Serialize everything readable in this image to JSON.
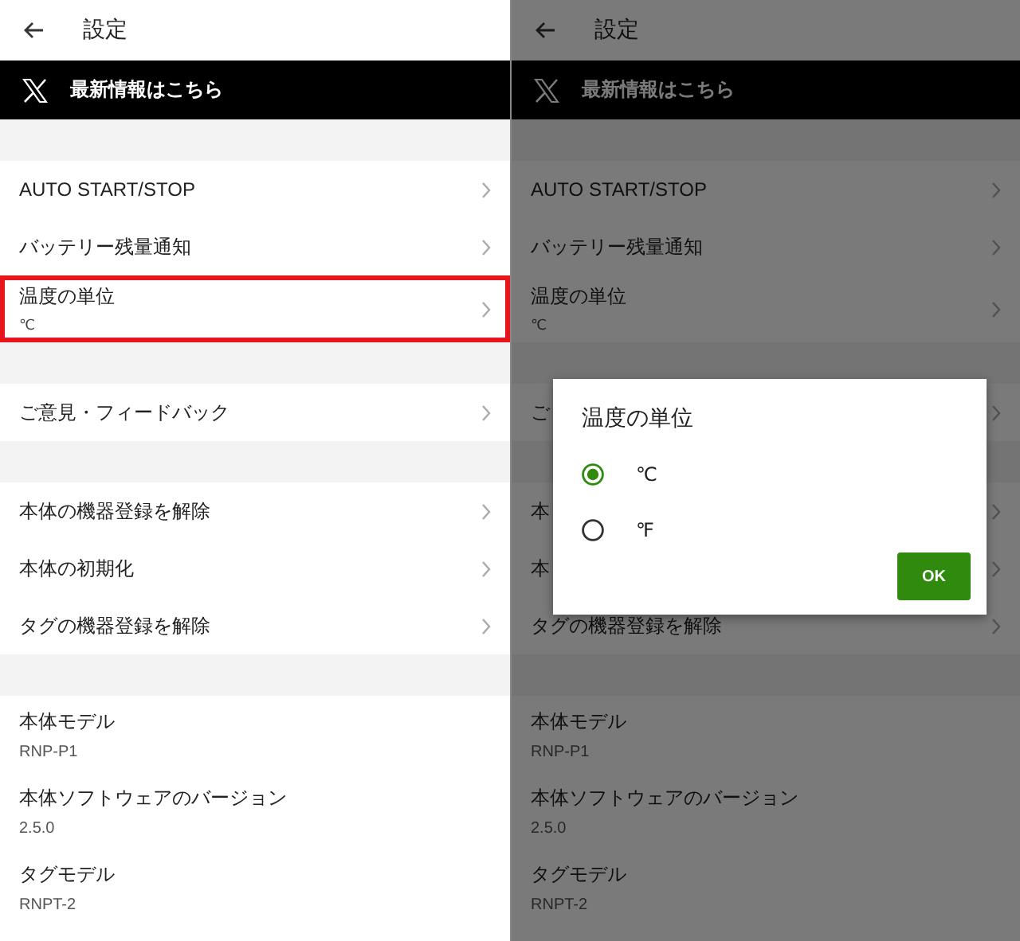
{
  "screens": [
    {
      "header": {
        "title": "設定"
      },
      "banner": {
        "text": "最新情報はこちら"
      },
      "dimmed": false,
      "groups": [
        {
          "items": [
            {
              "label": "AUTO START/STOP",
              "highlighted": false
            },
            {
              "label": "バッテリー残量通知",
              "highlighted": false
            },
            {
              "label": "温度の単位",
              "value": "℃",
              "highlighted": true
            }
          ]
        },
        {
          "items": [
            {
              "label": "ご意見・フィードバック",
              "highlighted": false
            }
          ]
        },
        {
          "items": [
            {
              "label": "本体の機器登録を解除",
              "highlighted": false
            },
            {
              "label": "本体の初期化",
              "highlighted": false
            },
            {
              "label": "タグの機器登録を解除",
              "highlighted": false
            }
          ]
        }
      ],
      "info": [
        {
          "label": "本体モデル",
          "value": "RNP-P1"
        },
        {
          "label": "本体ソフトウェアのバージョン",
          "value": "2.5.0"
        },
        {
          "label": "タグモデル",
          "value": "RNPT-2"
        }
      ]
    },
    {
      "header": {
        "title": "設定"
      },
      "banner": {
        "text": "最新情報はこちら"
      },
      "dimmed": true,
      "groups": [
        {
          "items": [
            {
              "label": "AUTO START/STOP",
              "highlighted": false
            },
            {
              "label": "バッテリー残量通知",
              "highlighted": false
            },
            {
              "label": "温度の単位",
              "value": "℃",
              "highlighted": false
            }
          ]
        },
        {
          "items": [
            {
              "label": "ご",
              "highlighted": false
            }
          ]
        },
        {
          "items": [
            {
              "label": "本",
              "highlighted": false
            },
            {
              "label": "本",
              "highlighted": false
            },
            {
              "label": "タグの機器登録を解除",
              "highlighted": false
            }
          ]
        }
      ],
      "info": [
        {
          "label": "本体モデル",
          "value": "RNP-P1"
        },
        {
          "label": "本体ソフトウェアのバージョン",
          "value": "2.5.0"
        },
        {
          "label": "タグモデル",
          "value": "RNPT-2"
        }
      ],
      "dialog": {
        "title": "温度の単位",
        "options": [
          {
            "label": "℃",
            "selected": true
          },
          {
            "label": "℉",
            "selected": false
          }
        ],
        "button": "OK"
      }
    }
  ]
}
